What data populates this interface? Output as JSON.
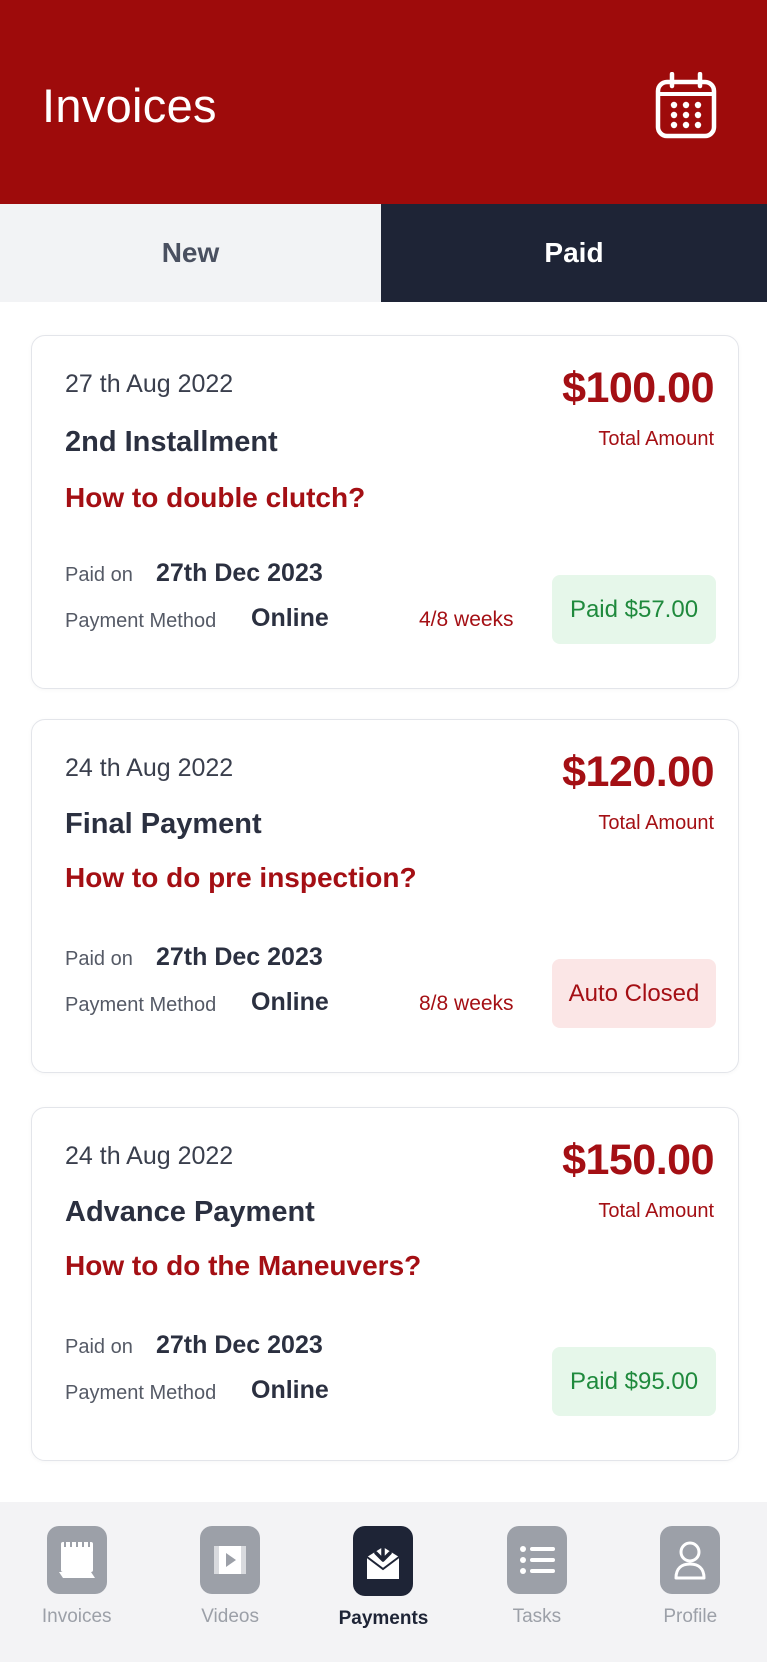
{
  "header": {
    "title": "Invoices",
    "calendar_icon": "calendar-icon"
  },
  "tabs": [
    {
      "label": "New",
      "active": false
    },
    {
      "label": "Paid",
      "active": true
    }
  ],
  "invoices": [
    {
      "date": "27 th Aug 2022",
      "title": "2nd Installment",
      "question": "How to double clutch?",
      "amount": "$100.00",
      "total_label": "Total Amount",
      "paid_on_label": "Paid on",
      "paid_on": "27th Dec 2023",
      "payment_method_label": "Payment Method",
      "payment_method": "Online",
      "weeks": "4/8 weeks",
      "status": "Paid $57.00"
    },
    {
      "date": "24 th Aug 2022",
      "title": "Final Payment",
      "question": "How to do pre inspection?",
      "amount": "$120.00",
      "total_label": "Total Amount",
      "paid_on_label": "Paid on",
      "paid_on": "27th Dec 2023",
      "payment_method_label": "Payment Method",
      "payment_method": "Online",
      "weeks": "8/8 weeks",
      "status": "Auto Closed"
    },
    {
      "date": "24 th Aug 2022",
      "title": "Advance Payment",
      "question": "How to do the Maneuvers?",
      "amount": "$150.00",
      "total_label": "Total Amount",
      "paid_on_label": "Paid on",
      "paid_on": "27th Dec 2023",
      "payment_method_label": "Payment Method",
      "payment_method": "Online",
      "weeks": "",
      "status": "Paid $95.00"
    }
  ],
  "bottom_nav": [
    {
      "label": "Invoices",
      "icon": "invoice-icon",
      "active": false
    },
    {
      "label": "Videos",
      "icon": "video-icon",
      "active": false
    },
    {
      "label": "Payments",
      "icon": "payment-icon",
      "active": true
    },
    {
      "label": "Tasks",
      "icon": "list-icon",
      "active": false
    },
    {
      "label": "Profile",
      "icon": "profile-icon",
      "active": false
    }
  ],
  "colors": {
    "brand_red": "#9e0b0b",
    "dark_navy": "#1e2436",
    "paid_green": "#1f8a3d",
    "closed_red": "#a40f14"
  }
}
